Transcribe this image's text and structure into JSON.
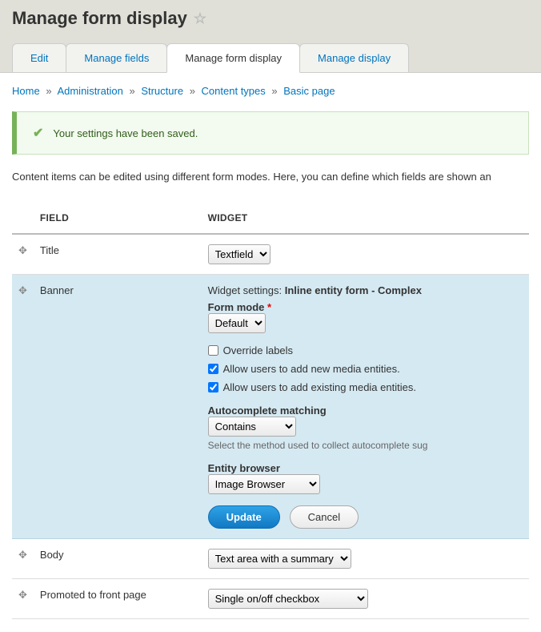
{
  "title": "Manage form display",
  "tabs": [
    {
      "label": "Edit"
    },
    {
      "label": "Manage fields"
    },
    {
      "label": "Manage form display",
      "active": true
    },
    {
      "label": "Manage display"
    }
  ],
  "breadcrumb": [
    {
      "label": "Home"
    },
    {
      "label": "Administration"
    },
    {
      "label": "Structure"
    },
    {
      "label": "Content types"
    },
    {
      "label": "Basic page"
    }
  ],
  "message": "Your settings have been saved.",
  "intro": "Content items can be edited using different form modes. Here, you can define which fields are shown an",
  "columns": {
    "field": "FIELD",
    "widget": "WIDGET"
  },
  "rows": {
    "title": {
      "field": "Title",
      "widget": "Textfield"
    },
    "banner": {
      "field": "Banner"
    },
    "body": {
      "field": "Body",
      "widget": "Text area with a summary"
    },
    "promoted": {
      "field": "Promoted to front page",
      "widget": "Single on/off checkbox"
    }
  },
  "banner_settings": {
    "widget_label_prefix": "Widget settings:",
    "widget_name": "Inline entity form - Complex",
    "form_mode_label": "Form mode",
    "form_mode_value": "Default",
    "override_labels": {
      "label": "Override labels",
      "checked": false
    },
    "allow_add": {
      "label": "Allow users to add new media entities.",
      "checked": true
    },
    "allow_existing": {
      "label": "Allow users to add existing media entities.",
      "checked": true
    },
    "autocomplete_label": "Autocomplete matching",
    "autocomplete_value": "Contains",
    "autocomplete_desc": "Select the method used to collect autocomplete sug",
    "entity_browser_label": "Entity browser",
    "entity_browser_value": "Image Browser",
    "update": "Update",
    "cancel": "Cancel"
  }
}
